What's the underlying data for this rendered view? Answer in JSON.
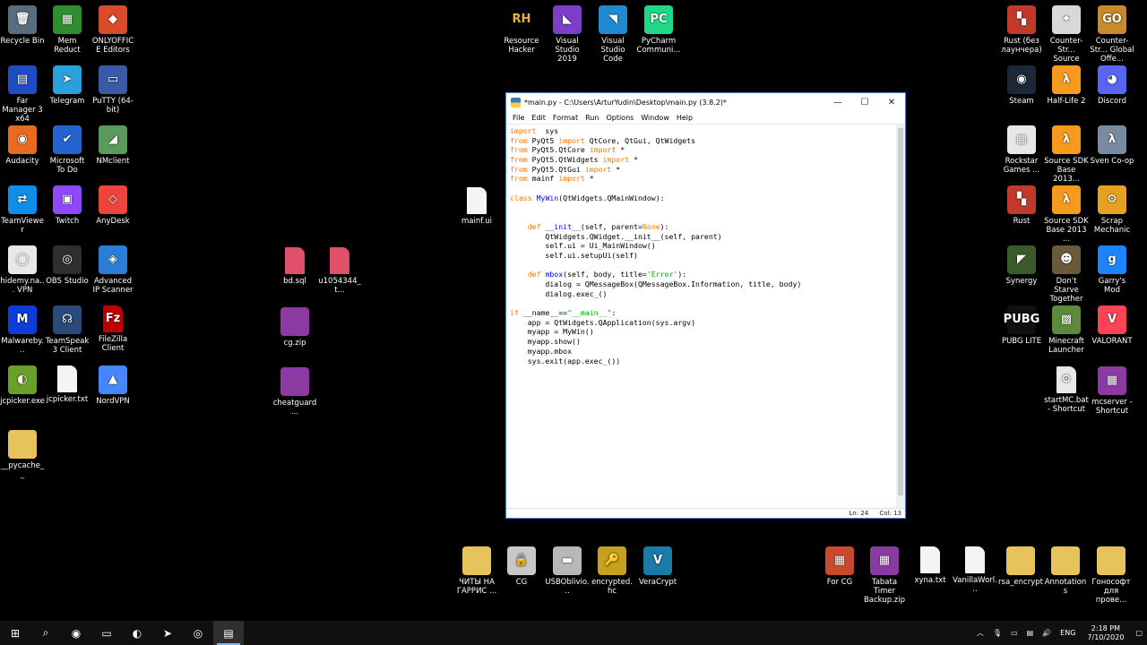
{
  "desktop_icons_left": [
    {
      "label": "Recycle Bin",
      "icon": "recycle-bin-icon",
      "color": "#5a6c80",
      "glyph": "🗑"
    },
    {
      "label": "Mem Reduct",
      "icon": "memreduct-icon",
      "color": "#2f8f2f",
      "glyph": "▦"
    },
    {
      "label": "ONLYOFFICE Editors",
      "icon": "onlyoffice-icon",
      "color": "#d94b2b",
      "glyph": "◆"
    },
    {
      "label": "Far Manager 3 x64",
      "icon": "far-manager-icon",
      "color": "#1e4cc4",
      "glyph": "▤"
    },
    {
      "label": "Telegram",
      "icon": "telegram-icon",
      "color": "#2aa1da",
      "glyph": "➤"
    },
    {
      "label": "PuTTY (64-bit)",
      "icon": "putty-icon",
      "color": "#3a5aa8",
      "glyph": "▭"
    },
    {
      "label": "Audacity",
      "icon": "audacity-icon",
      "color": "#e86a1e",
      "glyph": "◉"
    },
    {
      "label": "Microsoft To Do",
      "icon": "todo-icon",
      "color": "#2564cf",
      "glyph": "✔"
    },
    {
      "label": "NMclient",
      "icon": "nmclient-icon",
      "color": "#5a9a5a",
      "glyph": "◢"
    },
    {
      "label": "TeamViewer",
      "icon": "teamviewer-icon",
      "color": "#0e8ee9",
      "glyph": "⇄"
    },
    {
      "label": "Twitch",
      "icon": "twitch-icon",
      "color": "#9146ff",
      "glyph": "▣"
    },
    {
      "label": "AnyDesk",
      "icon": "anydesk-icon",
      "color": "#ef443b",
      "glyph": "◇"
    },
    {
      "label": "hidemy.na... VPN",
      "icon": "hidemy-vpn-icon",
      "color": "#e8e8e8",
      "glyph": "◯"
    },
    {
      "label": "OBS Studio",
      "icon": "obs-icon",
      "color": "#302e31",
      "glyph": "◎"
    },
    {
      "label": "Advanced IP Scanner",
      "icon": "ip-scanner-icon",
      "color": "#2a7fd4",
      "glyph": "◈"
    },
    {
      "label": "Malwareby...",
      "icon": "malwarebytes-icon",
      "color": "#0d3dd8",
      "glyph": "M"
    },
    {
      "label": "TeamSpeak 3 Client",
      "icon": "teamspeak-icon",
      "color": "#2a4a7a",
      "glyph": "☊"
    },
    {
      "label": "FileZilla Client",
      "icon": "filezilla-icon",
      "color": "#bf0000",
      "glyph": "Fz"
    },
    {
      "label": "jcpicker.exe",
      "icon": "jcpicker-icon",
      "color": "#6aa02a",
      "glyph": "◐"
    },
    {
      "label": "jcpicker.txt",
      "icon": "text-file-icon",
      "color": "#f4f4f4",
      "glyph": ""
    },
    {
      "label": "NordVPN",
      "icon": "nordvpn-icon",
      "color": "#4687ff",
      "glyph": "▲"
    },
    {
      "label": "__pycache__",
      "icon": "folder-icon",
      "color": "#e8c25a",
      "glyph": ""
    }
  ],
  "desktop_icons_mid": [
    {
      "label": "mainf.ui",
      "icon": "file-icon",
      "color": "#f4f4f4"
    },
    {
      "label": "bd.sql",
      "icon": "sql-file-icon",
      "color": "#e0506a"
    },
    {
      "label": "u1054344_t...",
      "icon": "sql-file-icon",
      "color": "#e0506a"
    },
    {
      "label": "cg.zip",
      "icon": "winrar-icon",
      "color": "#8a3aa0"
    },
    {
      "label": "cheatguard...",
      "icon": "winrar-icon",
      "color": "#8a3aa0"
    }
  ],
  "desktop_icons_top": [
    {
      "label": "Resource Hacker",
      "icon": "resource-hacker-icon",
      "color": "#000000",
      "glyph": "RH"
    },
    {
      "label": "Visual Studio 2019",
      "icon": "visual-studio-icon",
      "color": "#7c3fc8",
      "glyph": "◣"
    },
    {
      "label": "Visual Studio Code",
      "icon": "vscode-icon",
      "color": "#1f8ad2",
      "glyph": "◥"
    },
    {
      "label": "PyCharm Communi...",
      "icon": "pycharm-icon",
      "color": "#21d789",
      "glyph": "PC"
    }
  ],
  "desktop_icons_right": [
    {
      "label": "Rust (без лаунчера)",
      "icon": "rust-icon",
      "color": "#c0392b",
      "glyph": "▚"
    },
    {
      "label": "Counter-Str... Source",
      "icon": "css-icon",
      "color": "#d8d8d8",
      "glyph": "✦"
    },
    {
      "label": "Counter-Str... Global Offe...",
      "icon": "csgo-icon",
      "color": "#c88a2a",
      "glyph": "GO"
    },
    {
      "label": "Steam",
      "icon": "steam-icon",
      "color": "#1b2838",
      "glyph": "◉"
    },
    {
      "label": "Half-Life 2",
      "icon": "halflife2-icon",
      "color": "#f59a1c",
      "glyph": "λ"
    },
    {
      "label": "Discord",
      "icon": "discord-icon",
      "color": "#5865f2",
      "glyph": "◕"
    },
    {
      "label": "Rockstar Games ...",
      "icon": "rockstar-icon",
      "color": "#e7e7e7",
      "glyph": "▦"
    },
    {
      "label": "Source SDK Base 2013...",
      "icon": "source-sdk-icon",
      "color": "#f59a1c",
      "glyph": "λ"
    },
    {
      "label": "Sven Co-op",
      "icon": "sven-coop-icon",
      "color": "#7a8aa0",
      "glyph": "λ"
    },
    {
      "label": "Rust",
      "icon": "rust-icon",
      "color": "#c0392b",
      "glyph": "▚"
    },
    {
      "label": "Source SDK Base 2013 ...",
      "icon": "source-sdk-icon",
      "color": "#f59a1c",
      "glyph": "λ"
    },
    {
      "label": "Scrap Mechanic",
      "icon": "scrap-mechanic-icon",
      "color": "#e8a020",
      "glyph": "⚙"
    },
    {
      "label": "Synergy",
      "icon": "synergy-icon",
      "color": "#3a5a2a",
      "glyph": "◤"
    },
    {
      "label": "Don't Starve Together",
      "icon": "dont-starve-icon",
      "color": "#6a5a3a",
      "glyph": "☻"
    },
    {
      "label": "Garry's Mod",
      "icon": "garrys-mod-icon",
      "color": "#1a85ff",
      "glyph": "g"
    },
    {
      "label": "PUBG LITE",
      "icon": "pubg-icon",
      "color": "#101010",
      "glyph": "PUBG"
    },
    {
      "label": "Minecraft Launcher",
      "icon": "minecraft-icon",
      "color": "#5a8a3a",
      "glyph": "▩"
    },
    {
      "label": "VALORANT",
      "icon": "valorant-icon",
      "color": "#fa4454",
      "glyph": "V"
    },
    {
      "label": "startMC.bat - Shortcut",
      "icon": "bat-file-icon",
      "color": "#e8e8e8",
      "glyph": "⚙"
    },
    {
      "label": "mcserver - Shortcut",
      "icon": "winrar-icon",
      "color": "#8a3aa0",
      "glyph": "▦"
    }
  ],
  "desktop_icons_bottom": [
    {
      "label": "ЧИТЫ НА ГАРРИС ...",
      "icon": "folder-icon",
      "color": "#e8c25a",
      "glyph": ""
    },
    {
      "label": "CG",
      "icon": "lock-icon",
      "color": "#c8c8c8",
      "glyph": "🔒"
    },
    {
      "label": "USBOblivio...",
      "icon": "usboblivion-icon",
      "color": "#b8b8b8",
      "glyph": "▬"
    },
    {
      "label": "encrypted.hc",
      "icon": "encrypted-icon",
      "color": "#c8a020",
      "glyph": "🔑"
    },
    {
      "label": "VeraCrypt",
      "icon": "veracrypt-icon",
      "color": "#1a7aa8",
      "glyph": "V"
    },
    {
      "label": "For CG",
      "icon": "for-cg-icon",
      "color": "#c84a2a",
      "glyph": "▦"
    },
    {
      "label": "Tabata Timer Backup.zip",
      "icon": "winrar-icon",
      "color": "#8a3aa0",
      "glyph": "▦"
    },
    {
      "label": "xyna.txt",
      "icon": "text-file-icon",
      "color": "#f4f4f4",
      "glyph": ""
    },
    {
      "label": "VanillaWorl...",
      "icon": "text-file-icon",
      "color": "#f4f4f4",
      "glyph": ""
    },
    {
      "label": "rsa_encrypt",
      "icon": "folder-icon",
      "color": "#e8c25a",
      "glyph": ""
    },
    {
      "label": "Annotations",
      "icon": "folder-icon",
      "color": "#e8c25a",
      "glyph": ""
    },
    {
      "label": "Гонософт для прове...",
      "icon": "folder-icon",
      "color": "#e8c25a",
      "glyph": ""
    }
  ],
  "window": {
    "title": "*main.py - C:\\Users\\ArturYudin\\Desktop\\main.py (3.8.2)*",
    "menu": [
      "File",
      "Edit",
      "Format",
      "Run",
      "Options",
      "Window",
      "Help"
    ],
    "status_line": "Ln: 24",
    "status_col": "Col: 13",
    "minimize": "—",
    "maximize": "☐",
    "close": "✕"
  },
  "code_lines": [
    [
      [
        "kw",
        "import"
      ],
      [
        "",
        "  sys"
      ]
    ],
    [
      [
        "kw",
        "from"
      ],
      [
        "",
        " PyQt5 "
      ],
      [
        "kw",
        "import"
      ],
      [
        "",
        " QtCore, QtGui, QtWidgets"
      ]
    ],
    [
      [
        "kw",
        "from"
      ],
      [
        "",
        " PyQt5.QtCore "
      ],
      [
        "kw",
        "import"
      ],
      [
        "",
        " *"
      ]
    ],
    [
      [
        "kw",
        "from"
      ],
      [
        "",
        " PyQt5.QtWidgets "
      ],
      [
        "kw",
        "import"
      ],
      [
        "",
        " *"
      ]
    ],
    [
      [
        "kw",
        "from"
      ],
      [
        "",
        " PyQt5.QtGui "
      ],
      [
        "kw",
        "import"
      ],
      [
        "",
        " *"
      ]
    ],
    [
      [
        "kw",
        "from"
      ],
      [
        "",
        " mainf "
      ],
      [
        "kw",
        "import"
      ],
      [
        "",
        " *"
      ]
    ],
    [],
    [
      [
        "kw",
        "class"
      ],
      [
        "",
        " "
      ],
      [
        "fn",
        "MyWin"
      ],
      [
        "",
        "(QtWidgets.QMainWindow):"
      ]
    ],
    [],
    [],
    [
      [
        "",
        "    "
      ],
      [
        "kw",
        "def"
      ],
      [
        "",
        " "
      ],
      [
        "fn",
        "__init__"
      ],
      [
        "",
        "(self, parent="
      ],
      [
        "kw",
        "None"
      ],
      [
        "",
        "):"
      ]
    ],
    [
      [
        "",
        "        QtWidgets.QWidget.__init__(self, parent)"
      ]
    ],
    [
      [
        "",
        "        self.ui = Ui_MainWindow()"
      ]
    ],
    [
      [
        "",
        "        self.ui.setupUi(self)"
      ]
    ],
    [],
    [
      [
        "",
        "    "
      ],
      [
        "kw",
        "def"
      ],
      [
        "",
        " "
      ],
      [
        "fn",
        "mbox"
      ],
      [
        "",
        "(self, body, title="
      ],
      [
        "st",
        "'Error'"
      ],
      [
        "",
        "):"
      ]
    ],
    [
      [
        "",
        "        dialog = QMessageBox(QMessageBox.Information, title, body)"
      ]
    ],
    [
      [
        "",
        "        dialog.exec_()"
      ]
    ],
    [],
    [
      [
        "kw",
        "if"
      ],
      [
        "",
        " __name__=="
      ],
      [
        "st",
        "\"__main__\""
      ],
      [
        "",
        ":"
      ]
    ],
    [
      [
        "",
        "    app = QtWidgets.QApplication(sys.argv)"
      ]
    ],
    [
      [
        "",
        "    myapp = MyWin()"
      ]
    ],
    [
      [
        "",
        "    myapp.show()"
      ]
    ],
    [
      [
        "",
        "    myapp.mbox"
      ]
    ],
    [
      [
        "",
        "    sys.exit(app.exec_())"
      ]
    ]
  ],
  "taskbar": {
    "items": [
      {
        "icon": "windows-start-icon",
        "glyph": "⊞"
      },
      {
        "icon": "search-icon",
        "glyph": "⌕"
      },
      {
        "icon": "firefox-icon",
        "glyph": "◉"
      },
      {
        "icon": "file-explorer-icon",
        "glyph": "▭"
      },
      {
        "icon": "edge-icon",
        "glyph": "◐"
      },
      {
        "icon": "telegram-icon",
        "glyph": "➤"
      },
      {
        "icon": "obs-icon",
        "glyph": "◎"
      },
      {
        "icon": "idle-python-icon",
        "glyph": "▤"
      }
    ],
    "lang": "ENG",
    "time": "2:18 PM",
    "date": "7/10/2020"
  }
}
